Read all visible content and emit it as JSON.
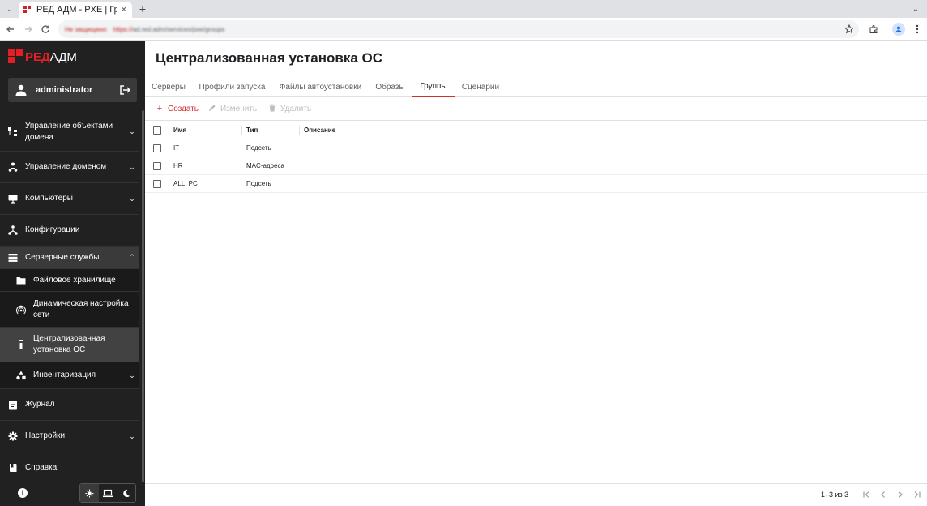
{
  "browser": {
    "tab_title": "РЕД АДМ - PXE | Группы",
    "close_glyph": "✕",
    "newtab_glyph": "+",
    "menu_glyph": "⌄",
    "win_glyph": "⌄",
    "security_label": "Не защищено",
    "url_scheme": "https://",
    "url_rest": "ad.red.adm/services/pxe/groups"
  },
  "sidebar": {
    "logo_red": "РЕД",
    "logo_white": "АДМ",
    "username": "administrator",
    "items": [
      {
        "label": "Управление объектами домена",
        "icon": "tree-icon"
      },
      {
        "label": "Управление доменом",
        "icon": "people-icon"
      },
      {
        "label": "Компьютеры",
        "icon": "monitor-icon"
      },
      {
        "label": "Конфигурации",
        "icon": "config-icon"
      },
      {
        "label": "Серверные службы",
        "icon": "server-icon"
      },
      {
        "label": "Файловое хранилище",
        "icon": "folder-icon"
      },
      {
        "label": "Динамическая настройка сети",
        "icon": "dhcp-icon"
      },
      {
        "label": "Централизованная установка ОС",
        "icon": "install-icon"
      },
      {
        "label": "Инвентаризация",
        "icon": "inventory-icon"
      },
      {
        "label": "Журнал",
        "icon": "journal-icon"
      },
      {
        "label": "Настройки",
        "icon": "gear-icon"
      },
      {
        "label": "Справка",
        "icon": "book-icon"
      }
    ],
    "chev_down": "⌄",
    "chev_up": "⌃"
  },
  "main": {
    "title": "Централизованная установка ОС",
    "tabs": [
      "Серверы",
      "Профили запуска",
      "Файлы автоустановки",
      "Образы",
      "Группы",
      "Сценарии"
    ],
    "selected_tab": "Группы",
    "actions": {
      "create": "Создать",
      "edit": "Изменить",
      "delete": "Удалить"
    },
    "columns": [
      "Имя",
      "Тип",
      "Описание"
    ],
    "rows": [
      {
        "name": "IT",
        "type": "Подсеть",
        "description": ""
      },
      {
        "name": "HR",
        "type": "MAC-адреса",
        "description": ""
      },
      {
        "name": "ALL_PC",
        "type": "Подсеть",
        "description": ""
      }
    ],
    "pagination": "1–3 из 3"
  },
  "colors": {
    "accent": "#d32f2f",
    "sidebar_bg": "#212121",
    "logo_red": "#e31e24"
  }
}
